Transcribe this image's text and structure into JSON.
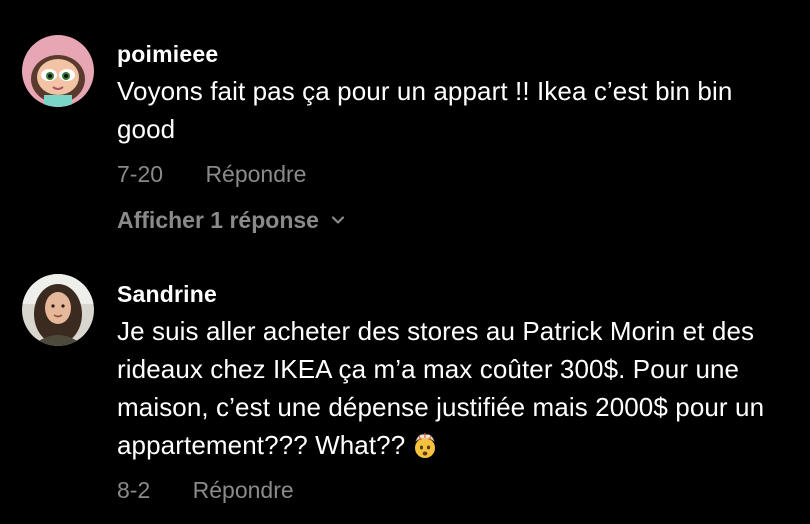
{
  "comments": [
    {
      "username": "poimieee",
      "text": "Voyons fait pas ça pour un appart !! Ikea c’est bin bin good",
      "date": "7-20",
      "reply_label": "Répondre",
      "view_replies_label": "Afficher 1 réponse"
    },
    {
      "username": "Sandrine",
      "text": "Je suis aller acheter des stores au Patrick Morin et des rideaux chez IKEA ça m’a max coûter 300$. Pour une maison, c’est une dépense justifiée mais 2000$ pour un appartement??? What??",
      "emoji": "exploding-head-emoji",
      "date": "8-2",
      "reply_label": "Répondre"
    }
  ],
  "colors": {
    "background": "#000000",
    "primary_text": "#ffffff",
    "secondary_text": "#8a8a8a"
  }
}
